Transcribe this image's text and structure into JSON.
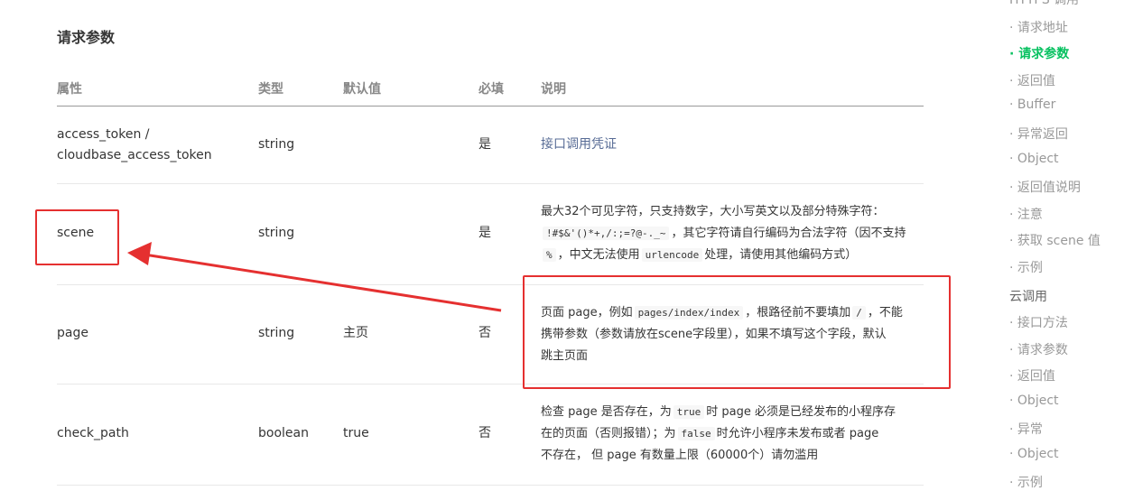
{
  "section": {
    "title": "请求参数"
  },
  "table": {
    "headers": [
      "属性",
      "类型",
      "默认值",
      "必填",
      "说明"
    ],
    "rows": [
      {
        "name_line1": "access_token /",
        "name_line2": "cloudbase_access_token",
        "type": "string",
        "default": "",
        "required": "是",
        "desc_link": "接口调用凭证"
      },
      {
        "name": "scene",
        "type": "string",
        "default": "",
        "required": "是",
        "desc_l1": "最大32个可见字符，只支持数字，大小写英文以及部分特殊字符：",
        "desc_code1": "!#$&'()*+,/:;=?@-._~",
        "desc_l2_text": "，其它字符请自行编码为合法字符（因不支持",
        "desc_code2": "%",
        "desc_l3_a": "，中文无法使用",
        "desc_code3": "urlencode",
        "desc_l3_b": "处理，请使用其他编码方式）"
      },
      {
        "name": "page",
        "type": "string",
        "default": "主页",
        "required": "否",
        "desc_a": "页面 page，例如",
        "desc_code1": "pages/index/index",
        "desc_b": "，根路径前不要填加",
        "desc_code2": "/",
        "desc_c": "，不能",
        "desc_l2": "携带参数（参数请放在scene字段里），如果不填写这个字段，默认",
        "desc_l3": "跳主页面"
      },
      {
        "name": "check_path",
        "type": "boolean",
        "default": "true",
        "required": "否",
        "desc_l1": "检查 page 是否存在，为",
        "desc_code1": "true",
        "desc_l1b": "时 page 必须是已经发布的小程序存",
        "desc_l2a": "在的页面（否则报错）；为",
        "desc_code2": "false",
        "desc_l2b": "时允许小程序未发布或者 page",
        "desc_l3": "不存在， 但 page 有数量上限（60000个）请勿滥用"
      }
    ]
  },
  "nav": {
    "cut_top": "HTTPS 调用",
    "items": [
      {
        "label": "请求地址",
        "type": "sub"
      },
      {
        "label": "请求参数",
        "type": "sub",
        "active": true
      },
      {
        "label": "返回值",
        "type": "sub"
      },
      {
        "label": "Buffer",
        "type": "sub"
      },
      {
        "label": "异常返回",
        "type": "sub"
      },
      {
        "label": "Object",
        "type": "sub"
      },
      {
        "label": "返回值说明",
        "type": "sub"
      },
      {
        "label": "注意",
        "type": "sub"
      },
      {
        "label": "获取 scene 值",
        "type": "sub"
      },
      {
        "label": "示例",
        "type": "sub"
      },
      {
        "label": "云调用",
        "type": "group"
      },
      {
        "label": "接口方法",
        "type": "sub"
      },
      {
        "label": "请求参数",
        "type": "sub"
      },
      {
        "label": "返回值",
        "type": "sub"
      },
      {
        "label": "Object",
        "type": "sub"
      },
      {
        "label": "异常",
        "type": "sub"
      },
      {
        "label": "Object",
        "type": "sub"
      },
      {
        "label": "示例",
        "type": "sub"
      }
    ]
  },
  "annotation": {
    "color": "#e53030"
  },
  "colors": {
    "link": "#576b95",
    "active_nav": "#07c160"
  }
}
